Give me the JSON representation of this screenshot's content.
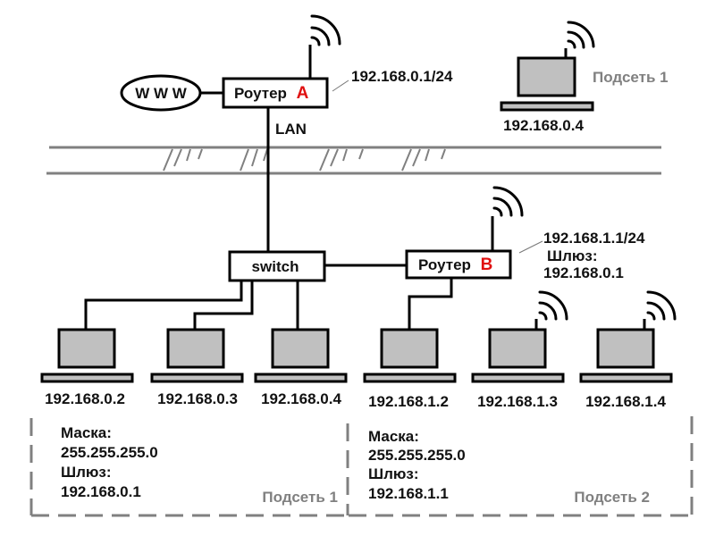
{
  "internet": {
    "label": "W W W"
  },
  "router_a": {
    "label": "Роутер",
    "letter": "A",
    "address": "192.168.0.1/24",
    "link_label": "LAN"
  },
  "router_b": {
    "label": "Роутер",
    "letter": "B",
    "address": "192.168.1.1/24",
    "gateway_label": "Шлюз:",
    "gateway": "192.168.0.1"
  },
  "switch": {
    "label": "switch"
  },
  "remote_host": {
    "ip": "192.168.0.4",
    "subnet_label": "Подсеть 1",
    "wireless": true
  },
  "hosts": [
    {
      "ip": "192.168.0.2",
      "wireless": false
    },
    {
      "ip": "192.168.0.3",
      "wireless": false
    },
    {
      "ip": "192.168.0.4",
      "wireless": false
    },
    {
      "ip": "192.168.1.2",
      "wireless": false
    },
    {
      "ip": "192.168.1.3",
      "wireless": true
    },
    {
      "ip": "192.168.1.4",
      "wireless": true
    }
  ],
  "subnets": [
    {
      "mask_label": "Маска:",
      "mask": "255.255.255.0",
      "gateway_label": "Шлюз:",
      "gateway": "192.168.0.1",
      "name": "Подсеть 1"
    },
    {
      "mask_label": "Маска:",
      "mask": "255.255.255.0",
      "gateway_label": "Шлюз:",
      "gateway": "192.168.1.1",
      "name": "Подсеть 2"
    }
  ],
  "colors": {
    "accent_letter": "#e01010",
    "device_fill": "#c0c0c0",
    "muted": "#808080"
  }
}
